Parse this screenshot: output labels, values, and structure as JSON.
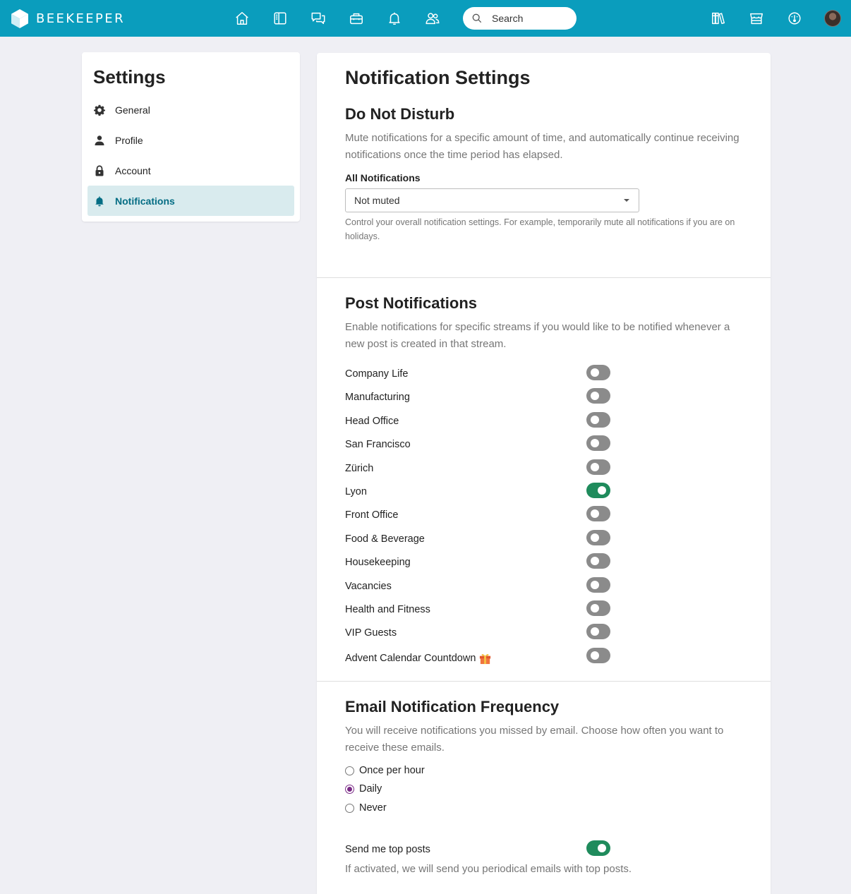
{
  "brand": {
    "name": "BEEKEEPER"
  },
  "topnav": {
    "icons": [
      "home-icon",
      "streams-icon",
      "chats-icon",
      "toolbox-icon",
      "bell-icon",
      "people-icon"
    ],
    "search_placeholder": "Search",
    "right_icons": [
      "library-icon",
      "store-icon",
      "dashboard-icon"
    ]
  },
  "sidebar": {
    "title": "Settings",
    "items": [
      {
        "label": "General",
        "icon": "gear-icon",
        "active": false
      },
      {
        "label": "Profile",
        "icon": "person-icon",
        "active": false
      },
      {
        "label": "Account",
        "icon": "lock-icon",
        "active": false
      },
      {
        "label": "Notifications",
        "icon": "bell-icon",
        "active": true
      }
    ]
  },
  "main": {
    "title": "Notification Settings",
    "dnd": {
      "heading": "Do Not Disturb",
      "description": "Mute notifications for a specific amount of time, and automatically continue receiving notifications once the time period has elapsed.",
      "field_label": "All Notifications",
      "select_value": "Not muted",
      "hint": "Control your overall notification settings. For example, temporarily mute all notifications if you are on holidays."
    },
    "posts": {
      "heading": "Post Notifications",
      "description": "Enable notifications for specific streams if you would like to be notified whenever a new post is created in that stream.",
      "streams": [
        {
          "name": "Company Life",
          "on": false
        },
        {
          "name": "Manufacturing",
          "on": false
        },
        {
          "name": "Head Office",
          "on": false
        },
        {
          "name": "San Francisco",
          "on": false
        },
        {
          "name": "Zürich",
          "on": false
        },
        {
          "name": "Lyon",
          "on": true
        },
        {
          "name": "Front Office",
          "on": false
        },
        {
          "name": "Food & Beverage",
          "on": false
        },
        {
          "name": "Housekeeping",
          "on": false
        },
        {
          "name": "Vacancies",
          "on": false
        },
        {
          "name": "Health and Fitness",
          "on": false
        },
        {
          "name": "VIP Guests",
          "on": false
        },
        {
          "name": "Advent Calendar Countdown",
          "on": false,
          "icon": "gift-icon"
        }
      ]
    },
    "email": {
      "heading": "Email Notification Frequency",
      "description": "You will receive notifications you missed by email. Choose how often you want to receive these emails.",
      "options": [
        {
          "label": "Once per hour",
          "checked": false
        },
        {
          "label": "Daily",
          "checked": true
        },
        {
          "label": "Never",
          "checked": false
        }
      ],
      "top_posts_label": "Send me top posts",
      "top_posts_on": true,
      "top_posts_hint": "If activated, we will send you periodical emails with top posts."
    }
  }
}
